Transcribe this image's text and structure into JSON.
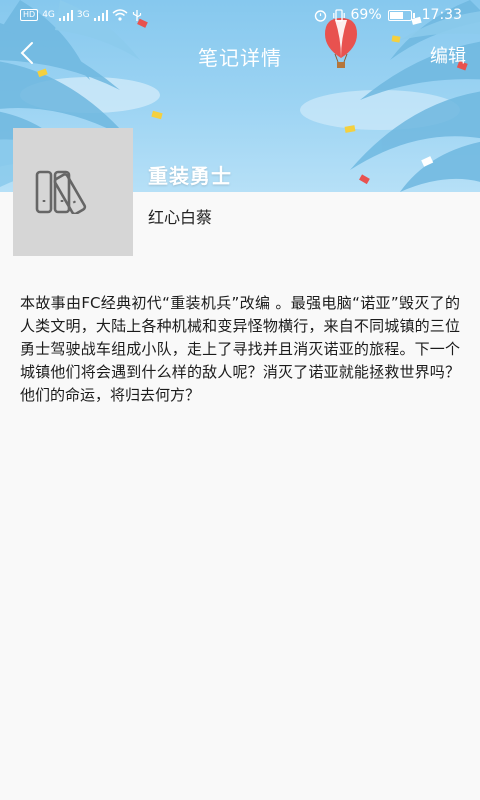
{
  "status_bar": {
    "left_labels": [
      "HD",
      "4G",
      "3G"
    ],
    "battery_text": "69%",
    "battery_level": 0.69,
    "time": "17:33"
  },
  "nav": {
    "back_icon": "chevron-left-icon",
    "title": "笔记详情",
    "edit_label": "编辑"
  },
  "book": {
    "title": "重装勇士",
    "author": "红心白蔡",
    "cover_icon": "books-icon"
  },
  "description": "本故事由FC经典初代“重装机兵”改编 。最强电脑“诺亚”毁灭了的人类文明，大陆上各种机械和变异怪物横行，来自不同城镇的三位勇士驾驶战车组成小队，走上了寻找并且消灭诺亚的旅程。下一个城镇他们将会遇到什么样的敌人呢？消灭了诺亚就能拯救世界吗？他们的命运，将归去何方？",
  "colors": {
    "sky": "#86c8ee",
    "background": "#f9f9f9",
    "cover_placeholder": "#d6d6d6"
  }
}
